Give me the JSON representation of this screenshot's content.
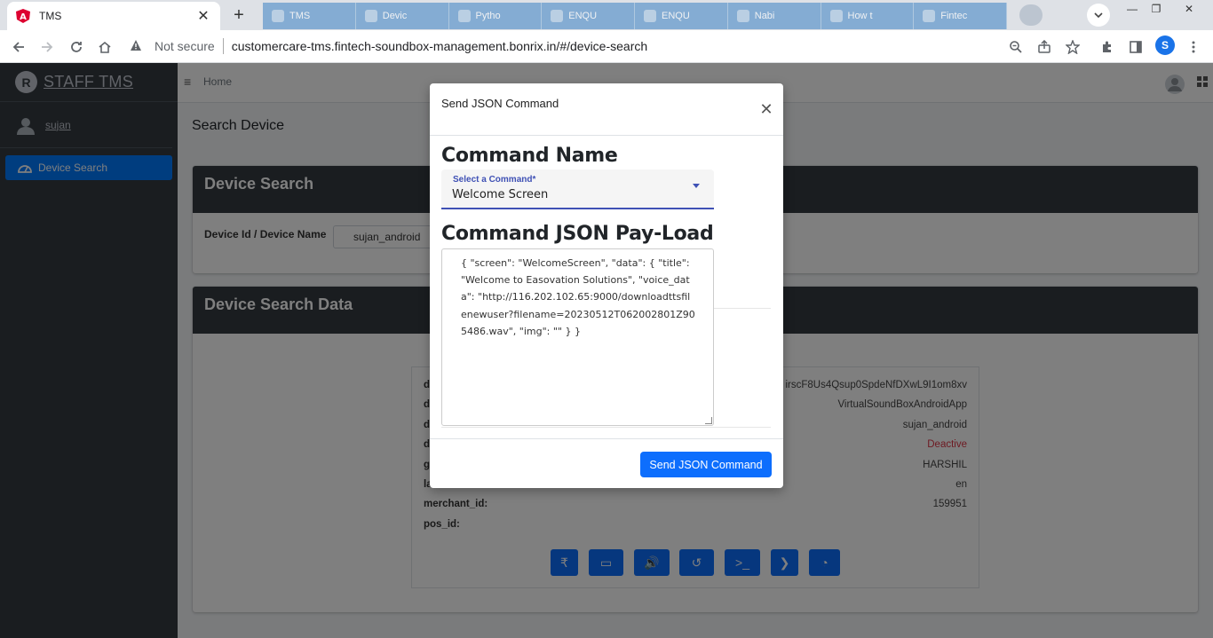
{
  "browser": {
    "tab_title": "TMS",
    "tab_close": "✕",
    "new_tab": "+",
    "background_tabs": [
      "TMS",
      "Devic",
      "Pytho",
      "ENQU",
      "ENQU",
      "Nabi",
      "How t",
      "Fintec"
    ],
    "not_secure": "Not secure",
    "url": "customercare-tms.fintech-soundbox-management.bonrix.in/#/device-search",
    "profile_initial": "S",
    "minimize": "—",
    "maximize": "❐",
    "close": "✕"
  },
  "sidebar": {
    "brand": "STAFF TMS",
    "brand_logo": "R",
    "user": "sujan",
    "nav_item": "Device Search"
  },
  "header": {
    "home": "Home"
  },
  "page": {
    "title": "Search Device",
    "search_card_title": "Device Search",
    "field_label": "Device Id / Device Name",
    "field_value": "sujan_android",
    "data_card_title": "Device Search Data"
  },
  "device_info": {
    "rows": [
      {
        "key": "d",
        "value": "irscF8Us4Qsup0SpdeNfDXwL9I1om8xv"
      },
      {
        "key": "d",
        "value": "VirtualSoundBoxAndroidApp"
      },
      {
        "key": "d",
        "value": "sujan_android"
      },
      {
        "key": "d",
        "value": "Deactive"
      },
      {
        "key": "g",
        "value": "HARSHIL"
      },
      {
        "key": "la",
        "value": "en"
      },
      {
        "key": "merchant_id:",
        "value": "159951"
      },
      {
        "key": "pos_id:",
        "value": ""
      }
    ],
    "action_icons": [
      "rupee-icon",
      "monitor-icon",
      "volume-icon",
      "history-icon",
      "terminal-icon",
      "chevron-right-icon",
      "rss-icon"
    ],
    "action_glyphs": [
      "₹",
      "▭",
      "🔊",
      "↺",
      ">_",
      "❯",
      "◔"
    ]
  },
  "modal": {
    "title": "Send JSON Command",
    "close": "✕",
    "command_name_heading": "Command Name",
    "select_label": "Select a Command*",
    "select_value": "Welcome Screen",
    "payload_heading": "Command JSON Pay-Load",
    "payload": "{ \"screen\": \"WelcomeScreen\", \"data\": { \"title\": \"Welcome to Easovation Solutions\", \"voice_data\": \"http://116.202.102.65:9000/downloadttsfilenewuser?filename=20230512T062002801Z905486.wav\", \"img\": \"\" } }",
    "send_button": "Send JSON Command"
  },
  "colors": {
    "primary": "#0d6efd",
    "sidebar": "#343a40",
    "select_accent": "#3f51b5",
    "deactive": "#dc3545"
  }
}
